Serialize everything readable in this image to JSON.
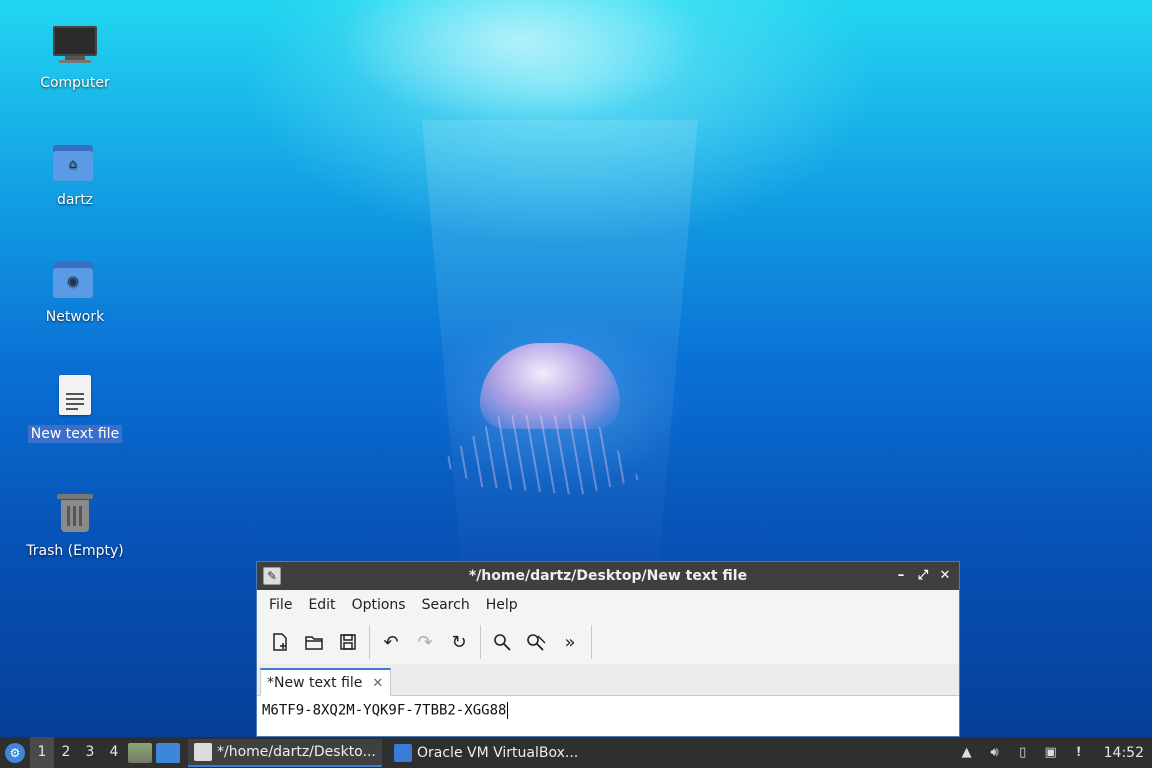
{
  "desktop": {
    "icons": [
      {
        "label": "Computer"
      },
      {
        "label": "dartz"
      },
      {
        "label": "Network"
      },
      {
        "label": "New text file"
      },
      {
        "label": "Trash (Empty)"
      }
    ]
  },
  "window": {
    "title": "*/home/dartz/Desktop/New text file",
    "menu": [
      "File",
      "Edit",
      "Options",
      "Search",
      "Help"
    ],
    "tab_label": "*New text file",
    "content": "M6TF9-8XQ2M-YQK9F-7TBB2-XGG88"
  },
  "taskbar": {
    "workspaces": [
      "1",
      "2",
      "3",
      "4"
    ],
    "tasks": [
      {
        "label": "*/home/dartz/Deskto..."
      },
      {
        "label": "Oracle VM VirtualBox..."
      }
    ],
    "clock": "14:52"
  },
  "colors": {
    "selection": "#3b6fc9",
    "accent": "#3d7ad8",
    "taskbar": "#2f2f2f",
    "titlebar": "#3f3f3f"
  }
}
